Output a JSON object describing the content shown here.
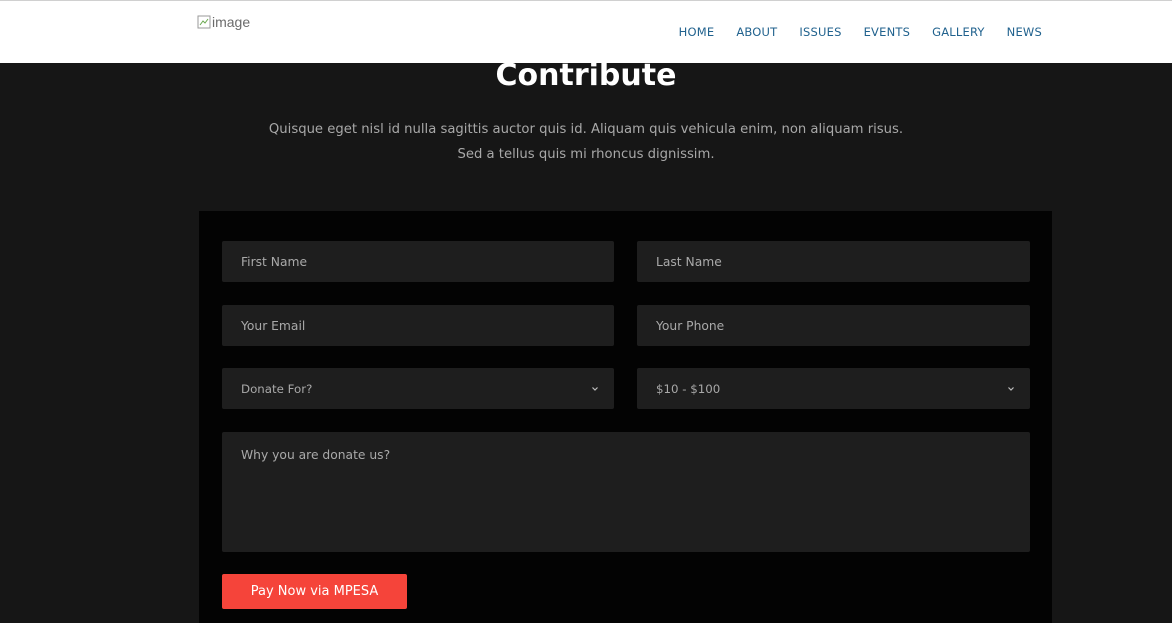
{
  "header": {
    "logo_alt": "image",
    "nav": [
      "HOME",
      "ABOUT",
      "ISSUES",
      "EVENTS",
      "GALLERY",
      "NEWS"
    ]
  },
  "hero": {
    "title": "Contribute",
    "subtitle_line1": "Quisque eget nisl id nulla sagittis auctor quis id. Aliquam quis vehicula enim, non aliquam risus.",
    "subtitle_line2": "Sed a tellus quis mi rhoncus dignissim."
  },
  "form": {
    "first_name_placeholder": "First Name",
    "last_name_placeholder": "Last Name",
    "email_placeholder": "Your Email",
    "phone_placeholder": "Your Phone",
    "donate_for_value": "Donate For?",
    "amount_value": "$10 - $100",
    "message_placeholder": "Why you are donate us?",
    "submit_label": "Pay Now via MPESA"
  },
  "colors": {
    "nav_link": "#21628e",
    "button": "#f5443a",
    "panel": "#030303",
    "background": "#161616",
    "field": "#1e1e1e"
  },
  "icons": {
    "logo": "broken-image-icon",
    "select": "chevron-down-icon"
  }
}
